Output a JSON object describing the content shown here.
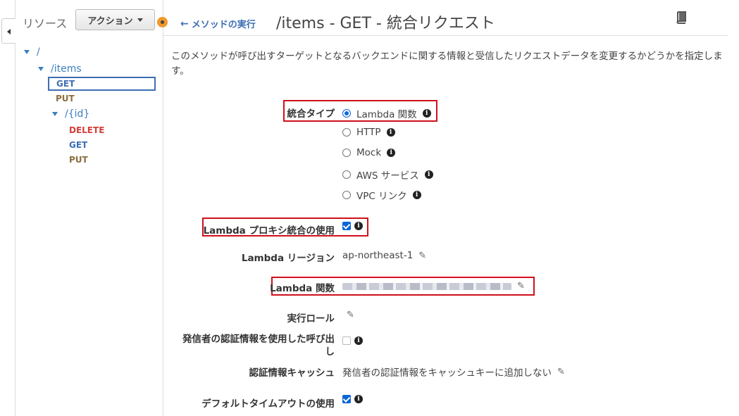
{
  "sidebar": {
    "title": "リソース",
    "action_label": "アクション",
    "tree": {
      "root": "/",
      "items": "/items",
      "items_methods": [
        "GET",
        "PUT"
      ],
      "id": "/{id}",
      "id_methods": [
        "DELETE",
        "GET",
        "PUT"
      ]
    }
  },
  "header": {
    "back_label": "メソッドの実行",
    "title": "/items - GET - 統合リクエスト"
  },
  "description": "このメソッドが呼び出すターゲットとなるバックエンドに関する情報と受信したリクエストデータを変更するかどうかを指定します。",
  "form": {
    "integration_type_label": "統合タイプ",
    "integration_options": [
      "Lambda 関数",
      "HTTP",
      "Mock",
      "AWS サービス",
      "VPC リンク"
    ],
    "selected_option": "Lambda 関数",
    "proxy_label": "Lambda プロキシ統合の使用",
    "proxy_checked": true,
    "region_label": "Lambda リージョン",
    "region_value": "ap-northeast-1",
    "function_label": "Lambda 関数",
    "role_label": "実行ロール",
    "caller_cred_label_line1": "発信者の認証情報を使用した呼び出",
    "caller_cred_label_line2": "し",
    "caller_cred_checked": false,
    "cache_label": "認証情報キャッシュ",
    "cache_value": "発信者の認証情報をキャッシュキーに追加しない",
    "timeout_label": "デフォルトタイムアウトの使用",
    "timeout_checked": true
  },
  "colors": {
    "link": "#3d6eb4",
    "delete": "#d43f3a",
    "put": "#8c6d3f",
    "highlight": "#d0101c",
    "accent": "#f1982b"
  }
}
